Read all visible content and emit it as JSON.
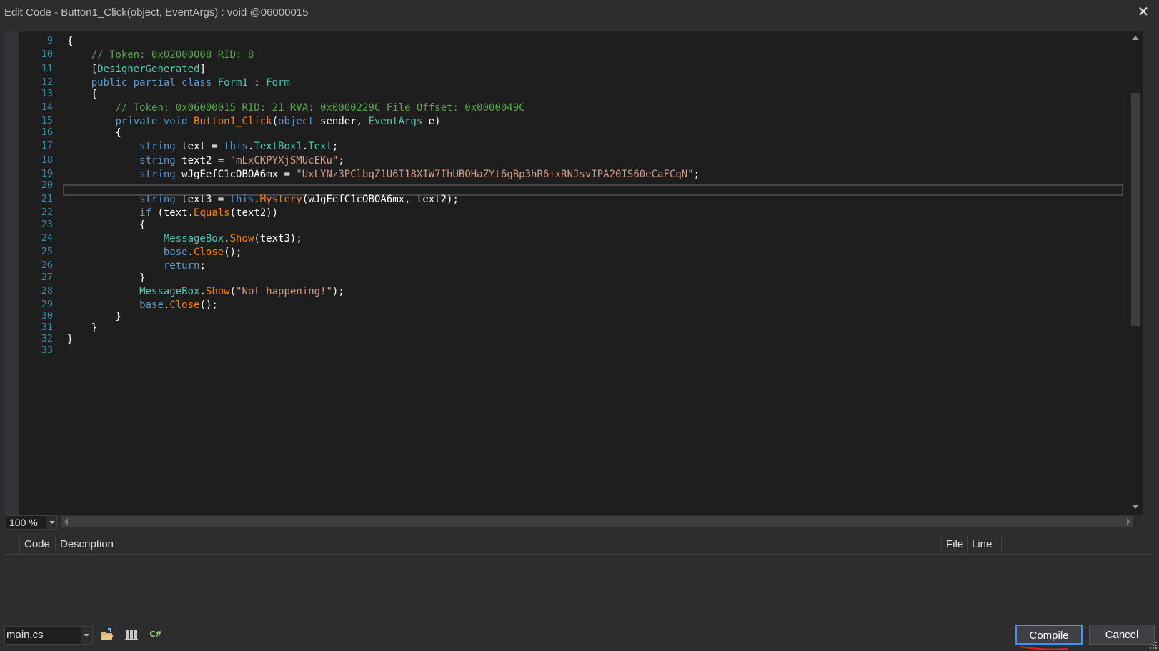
{
  "window": {
    "title": "Edit Code - Button1_Click(object, EventArgs) : void @06000015",
    "close_glyph": "✕"
  },
  "editor": {
    "line_numbers": [
      "9",
      "10",
      "11",
      "12",
      "13",
      "14",
      "15",
      "16",
      "17",
      "18",
      "19",
      "20",
      "21",
      "22",
      "23",
      "24",
      "25",
      "26",
      "27",
      "28",
      "29",
      "30",
      "31",
      "32",
      "33"
    ],
    "lines": [
      [
        [
          "pn",
          "{"
        ]
      ],
      [
        [
          "pn",
          "    "
        ],
        [
          "cm",
          "// Token: 0x02000008 RID: 8"
        ]
      ],
      [
        [
          "pn",
          "    ["
        ],
        [
          "ty",
          "DesignerGenerated"
        ],
        [
          "pn",
          "]"
        ]
      ],
      [
        [
          "pn",
          "    "
        ],
        [
          "kw",
          "public partial class "
        ],
        [
          "ty",
          "Form1"
        ],
        [
          "pn",
          " : "
        ],
        [
          "ty",
          "Form"
        ]
      ],
      [
        [
          "pn",
          "    {"
        ]
      ],
      [
        [
          "pn",
          "        "
        ],
        [
          "cm",
          "// Token: 0x06000015 RID: 21 RVA: 0x0000229C File Offset: 0x0000049C"
        ]
      ],
      [
        [
          "pn",
          "        "
        ],
        [
          "kw",
          "private void "
        ],
        [
          "mt",
          "Button1_Click"
        ],
        [
          "pn",
          "("
        ],
        [
          "kw",
          "object"
        ],
        [
          "pn",
          " sender, "
        ],
        [
          "ty",
          "EventArgs"
        ],
        [
          "pn",
          " e)"
        ]
      ],
      [
        [
          "pn",
          "        {"
        ]
      ],
      [
        [
          "pn",
          "            "
        ],
        [
          "kw",
          "string"
        ],
        [
          "pn",
          " text = "
        ],
        [
          "kw",
          "this"
        ],
        [
          "pn",
          "."
        ],
        [
          "pr",
          "TextBox1"
        ],
        [
          "pn",
          "."
        ],
        [
          "pr",
          "Text"
        ],
        [
          "pn",
          ";"
        ]
      ],
      [
        [
          "pn",
          "            "
        ],
        [
          "kw",
          "string"
        ],
        [
          "pn",
          " text2 = "
        ],
        [
          "st",
          "\"mLxCKPYXjSMUcEKu\""
        ],
        [
          "pn",
          ";"
        ]
      ],
      [
        [
          "pn",
          "            "
        ],
        [
          "kw",
          "string"
        ],
        [
          "pn",
          " wJgEefC1cOBOA6mx = "
        ],
        [
          "st",
          "\"UxLYNz3PClbqZ1U6I18XIW7IhUBOHaZYt6gBp3hR6+xRNJsvIPA20IS60eCaFCqN\""
        ],
        [
          "pn",
          ";"
        ]
      ],
      [
        [
          "pn",
          ""
        ]
      ],
      [
        [
          "pn",
          "            "
        ],
        [
          "kw",
          "string"
        ],
        [
          "pn",
          " text3 = "
        ],
        [
          "kw",
          "this"
        ],
        [
          "pn",
          "."
        ],
        [
          "mt",
          "Mystery"
        ],
        [
          "pn",
          "(wJgEefC1cOBOA6mx, text2);"
        ]
      ],
      [
        [
          "pn",
          "            "
        ],
        [
          "kw",
          "if"
        ],
        [
          "pn",
          " (text."
        ],
        [
          "mt",
          "Equals"
        ],
        [
          "pn",
          "(text2))"
        ]
      ],
      [
        [
          "pn",
          "            {"
        ]
      ],
      [
        [
          "pn",
          "                "
        ],
        [
          "ty",
          "MessageBox"
        ],
        [
          "pn",
          "."
        ],
        [
          "mt",
          "Show"
        ],
        [
          "pn",
          "(text3);"
        ]
      ],
      [
        [
          "pn",
          "                "
        ],
        [
          "kw",
          "base"
        ],
        [
          "pn",
          "."
        ],
        [
          "mt",
          "Close"
        ],
        [
          "pn",
          "();"
        ]
      ],
      [
        [
          "pn",
          "                "
        ],
        [
          "kw",
          "return"
        ],
        [
          "pn",
          ";"
        ]
      ],
      [
        [
          "pn",
          "            }"
        ]
      ],
      [
        [
          "pn",
          "            "
        ],
        [
          "ty",
          "MessageBox"
        ],
        [
          "pn",
          "."
        ],
        [
          "mt",
          "Show"
        ],
        [
          "pn",
          "("
        ],
        [
          "st",
          "\"Not happening!\""
        ],
        [
          "pn",
          ");"
        ]
      ],
      [
        [
          "pn",
          "            "
        ],
        [
          "kw",
          "base"
        ],
        [
          "pn",
          "."
        ],
        [
          "mt",
          "Close"
        ],
        [
          "pn",
          "();"
        ]
      ],
      [
        [
          "pn",
          "        }"
        ]
      ],
      [
        [
          "pn",
          "    }"
        ]
      ],
      [
        [
          "pn",
          "}"
        ]
      ],
      [
        [
          "pn",
          ""
        ]
      ]
    ],
    "zoom": "100 %"
  },
  "error_list": {
    "columns": {
      "code": "Code",
      "description": "Description",
      "file": "File",
      "line": "Line"
    }
  },
  "bottom": {
    "file_select": "main.cs",
    "csharp_glyph": "C#",
    "compile_label": "Compile",
    "cancel_label": "Cancel"
  },
  "colors": {
    "keyword": "#569cd6",
    "comment": "#57a64a",
    "type": "#4ec9b0",
    "string": "#d69d85",
    "method": "#ff8000",
    "line_number": "#2b91af",
    "focus_border": "#3399ff"
  }
}
